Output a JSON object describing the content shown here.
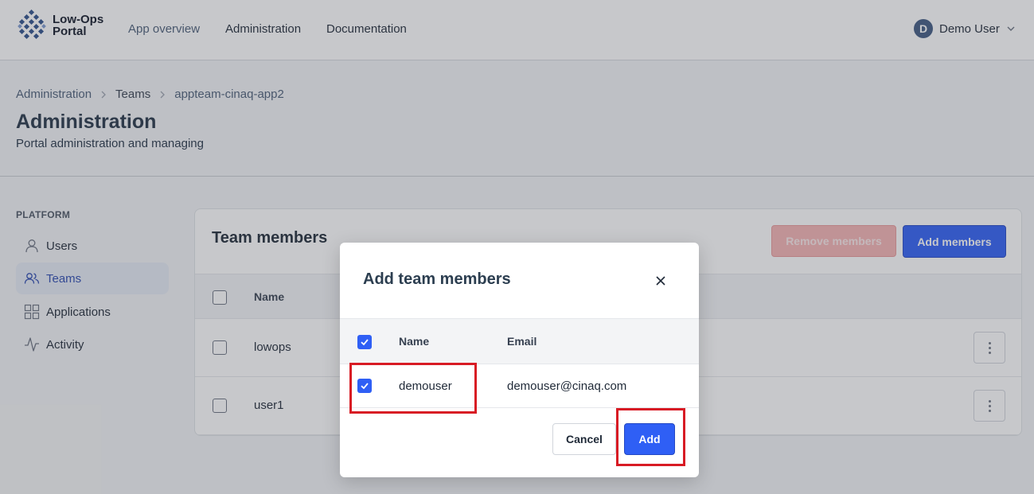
{
  "header": {
    "brand_line1": "Low-Ops",
    "brand_line2": "Portal",
    "nav": [
      {
        "label": "App overview"
      },
      {
        "label": "Administration"
      },
      {
        "label": "Documentation"
      }
    ],
    "user": {
      "initial": "D",
      "name": "Demo User"
    }
  },
  "breadcrumb": [
    "Administration",
    "Teams",
    "appteam-cinaq-app2"
  ],
  "page": {
    "title": "Administration",
    "subtitle": "Portal administration and managing"
  },
  "sidebar": {
    "heading": "PLATFORM",
    "items": [
      {
        "label": "Users",
        "icon": "user-icon"
      },
      {
        "label": "Teams",
        "icon": "users-icon",
        "active": true
      },
      {
        "label": "Applications",
        "icon": "grid-icon"
      },
      {
        "label": "Activity",
        "icon": "activity-icon"
      }
    ]
  },
  "card": {
    "title": "Team members",
    "remove_label": "Remove members",
    "add_label": "Add members",
    "column_name": "Name",
    "rows": [
      {
        "name": "lowops"
      },
      {
        "name": "user1"
      }
    ]
  },
  "modal": {
    "title": "Add team members",
    "col_name": "Name",
    "col_email": "Email",
    "rows": [
      {
        "name": "demouser",
        "email": "demouser@cinaq.com",
        "checked": true
      }
    ],
    "cancel_label": "Cancel",
    "add_label": "Add"
  },
  "colors": {
    "primary": "#2f5ff5",
    "danger_disabled": "#f5b3b3",
    "highlight": "#d81b24"
  }
}
